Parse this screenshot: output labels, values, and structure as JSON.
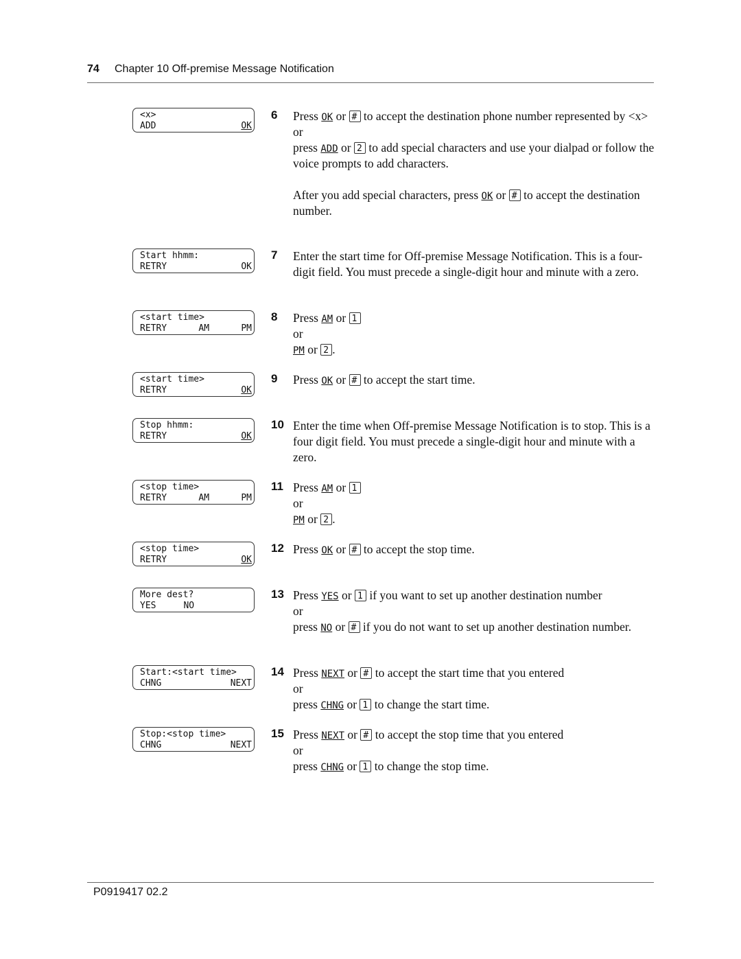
{
  "header": {
    "page_number": "74",
    "chapter_title": "Chapter 10  Off-premise Message Notification"
  },
  "footer": {
    "doc_id": "P0919417 02.2"
  },
  "displays": [
    {
      "line1": "<x>",
      "left": "ADD",
      "mid": "",
      "right": "OK",
      "right_underline": true
    },
    {
      "line1": "Start hhmm:",
      "left": "RETRY",
      "mid": "",
      "right": "OK",
      "right_underline": false
    },
    {
      "line1": "<start time>",
      "left": "RETRY",
      "mid": "AM",
      "right": "PM",
      "right_underline": false
    },
    {
      "line1": "<start time>",
      "left": "RETRY",
      "mid": "",
      "right": "OK",
      "right_underline": true
    },
    {
      "line1": "Stop hhmm:",
      "left": "RETRY",
      "mid": "",
      "right": "OK",
      "right_underline": true
    },
    {
      "line1": "<stop time>",
      "left": "RETRY",
      "mid": "AM",
      "right": "PM",
      "right_underline": false
    },
    {
      "line1": "<stop time>",
      "left": "RETRY",
      "mid": "",
      "right": "OK",
      "right_underline": true
    },
    {
      "line1": "More dest?",
      "left": "YES",
      "mid": "NO",
      "right": "",
      "right_underline": false
    },
    {
      "line1": "Start:<start time>",
      "left": "CHNG",
      "mid": "",
      "right": "NEXT",
      "right_underline": false
    },
    {
      "line1": "Stop:<stop time>",
      "left": "CHNG",
      "mid": "",
      "right": "NEXT",
      "right_underline": false
    }
  ],
  "steps": {
    "s6": {
      "num": "6",
      "press": "Press",
      "sk1": "OK",
      "or": "or",
      "key1": "#",
      "t1": "to accept the destination phone number represented by <x>",
      "or_line": "or",
      "press2": "press",
      "sk2": "ADD",
      "key2": "2",
      "t2": "to add special characters and use your dialpad or follow the voice prompts to add characters.",
      "after": "After you add special characters, press",
      "sk3": "OK",
      "key3": "#",
      "t3": "to accept the destination number."
    },
    "s7": {
      "num": "7",
      "text": "Enter the start time for Off-premise Message Notification. This is a four-digit field. You must precede a single-digit hour and minute with a zero."
    },
    "s8": {
      "num": "8",
      "press": "Press",
      "sk1": "AM",
      "or": "or",
      "key1": "1",
      "or_line": "or",
      "sk2": "PM",
      "key2": "2",
      "end": "."
    },
    "s9": {
      "num": "9",
      "press": "Press",
      "sk1": "OK",
      "or": "or",
      "key1": "#",
      "t1": "to accept the start time."
    },
    "s10": {
      "num": "10",
      "text": "Enter the time when Off-premise Message Notification is to stop. This is a four digit field. You must precede a single-digit hour and minute with a zero."
    },
    "s11": {
      "num": "11",
      "press": "Press",
      "sk1": "AM",
      "or": "or",
      "key1": "1",
      "or_line": "or",
      "sk2": "PM",
      "key2": "2",
      "end": "."
    },
    "s12": {
      "num": "12",
      "press": "Press",
      "sk1": "OK",
      "or": "or",
      "key1": "#",
      "t1": "to accept the stop time."
    },
    "s13": {
      "num": "13",
      "press": "Press",
      "sk1": "YES",
      "or": "or",
      "key1": "1",
      "t1": "if you want to set up another destination number",
      "or_line": "or",
      "press2": "press",
      "sk2": "NO",
      "key2": "#",
      "t2": "if you do not want to set up another destination number."
    },
    "s14": {
      "num": "14",
      "press": "Press",
      "sk1": "NEXT",
      "or": "or",
      "key1": "#",
      "t1": "to accept the start time that you entered",
      "or_line": "or",
      "press2": "press",
      "sk2": "CHNG",
      "key2": "1",
      "t2": "to change the start time."
    },
    "s15": {
      "num": "15",
      "press": "Press",
      "sk1": "NEXT",
      "or": "or",
      "key1": "#",
      "t1": "to accept the stop time that you entered",
      "or_line": "or",
      "press2": "press",
      "sk2": "CHNG",
      "key2": "1",
      "t2": "to change the stop time."
    }
  }
}
